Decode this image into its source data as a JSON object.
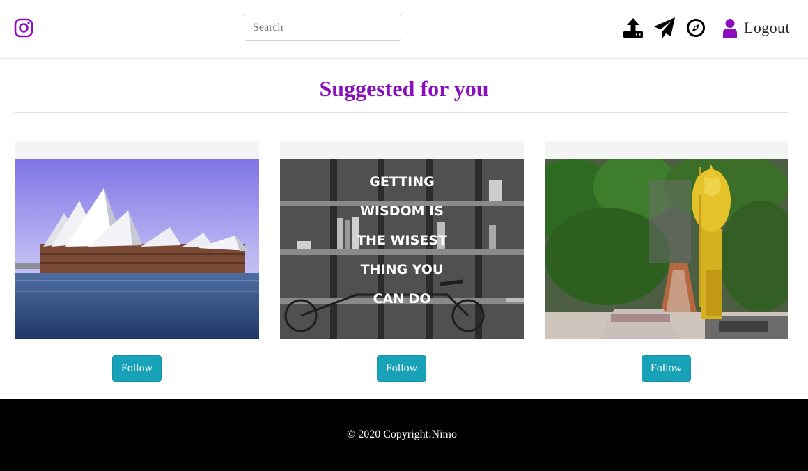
{
  "navbar": {
    "brand_icon": "instagram-logo-icon",
    "brand_color": "#8b0fbf",
    "search": {
      "placeholder": "Search",
      "value": ""
    },
    "icons": [
      "upload-icon",
      "paper-plane-icon",
      "compass-icon"
    ],
    "logout": {
      "icon": "user-icon",
      "label": "Logout",
      "icon_color": "#8b0fbf"
    }
  },
  "page": {
    "title": "Suggested for you",
    "title_color": "#8b0fbf"
  },
  "suggestions": [
    {
      "image": "sydney-opera-house-photo",
      "button_label": "Follow"
    },
    {
      "image": "bookshelf-quote-photo",
      "quote_lines": [
        "GETTING",
        "WISDOM IS",
        "THE WISEST",
        "THING YOU",
        "CAN DO"
      ],
      "button_label": "Follow"
    },
    {
      "image": "batu-caves-statue-photo",
      "button_label": "Follow"
    }
  ],
  "button_color": "#17a2b8",
  "footer": {
    "copyright": "© 2020 Copyright:Nimo"
  }
}
